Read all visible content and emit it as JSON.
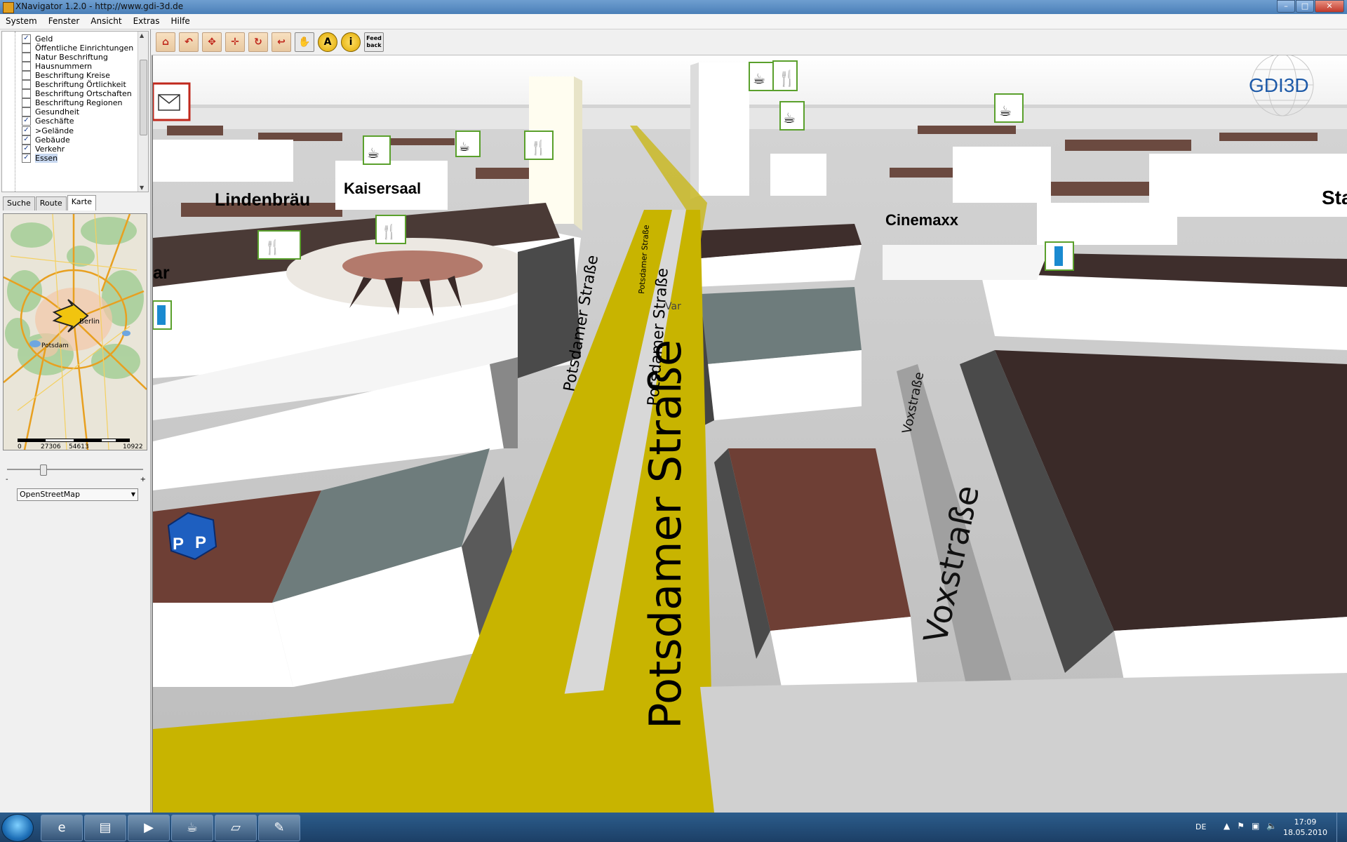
{
  "window": {
    "title": "XNavigator 1.2.0 - http://www.gdi-3d.de",
    "min": "–",
    "max": "□",
    "close": "✕"
  },
  "menu": [
    "System",
    "Fenster",
    "Ansicht",
    "Extras",
    "Hilfe"
  ],
  "layers": [
    {
      "label": "Geld",
      "checked": true
    },
    {
      "label": "Öffentliche Einrichtungen",
      "checked": false
    },
    {
      "label": "Natur Beschriftung",
      "checked": false
    },
    {
      "label": "Hausnummern",
      "checked": false
    },
    {
      "label": "Beschriftung Kreise",
      "checked": false
    },
    {
      "label": "Beschriftung Örtlichkeit",
      "checked": false
    },
    {
      "label": "Beschriftung Ortschaften",
      "checked": false
    },
    {
      "label": "Beschriftung Regionen",
      "checked": false
    },
    {
      "label": "Gesundheit",
      "checked": false
    },
    {
      "label": "Geschäfte",
      "checked": true
    },
    {
      "label": ">Gelände",
      "checked": true
    },
    {
      "label": "Gebäude",
      "checked": true
    },
    {
      "label": "Verkehr",
      "checked": true
    },
    {
      "label": "Essen",
      "checked": true,
      "selected": true
    }
  ],
  "tabs": [
    "Suche",
    "Route",
    "Karte"
  ],
  "minimap": {
    "labels": {
      "berlin": "Berlin",
      "potsdam": "Potsdam"
    },
    "scale": [
      "0",
      "27306",
      "54613",
      "10922"
    ]
  },
  "zoom": {
    "minus": "-",
    "plus": "+",
    "level": 0.25
  },
  "map_source": "OpenStreetMap",
  "toolbar": {
    "tools": [
      "home-icon",
      "back-icon",
      "rotate-icon",
      "move-icon",
      "refresh-icon",
      "undo-icon",
      "hand-icon",
      "label-icon",
      "info-icon",
      "feedback-icon"
    ],
    "glyphs": [
      "⌂",
      "↶",
      "✥",
      "✛",
      "↻",
      "↩",
      "✋",
      "A",
      "i",
      "Feed back"
    ]
  },
  "scene": {
    "logo": "GDI3D",
    "labels": {
      "lindenbraeu": "Lindenbräu",
      "kaisersaal": "Kaisersaal",
      "cinemaxx": "Cinemaxx",
      "ar": "ar",
      "sta": "Sta",
      "potsdamer_big": "Potsdamer Straße",
      "potsdamer_left": "Potsdamer Straße",
      "potsdamer_mid": "Potsdamer Straße",
      "potsdamer_tiny": "Potsdamer Straße",
      "voxstrasse_big": "Voxstraße",
      "voxstrasse_small": "Voxstraße",
      "var": "Var"
    },
    "colors": {
      "road": "#c8b400",
      "roof_brown": "#6e3f35",
      "roof_grey": "#6e7c7c",
      "roof_dark": "#3a2a28",
      "wall": "#ffffff"
    }
  },
  "taskbar": {
    "lang": "DE",
    "time": "17:09",
    "date": "18.05.2010",
    "tray_icons": [
      "▲",
      "⚑",
      "▣",
      "🔈"
    ]
  }
}
